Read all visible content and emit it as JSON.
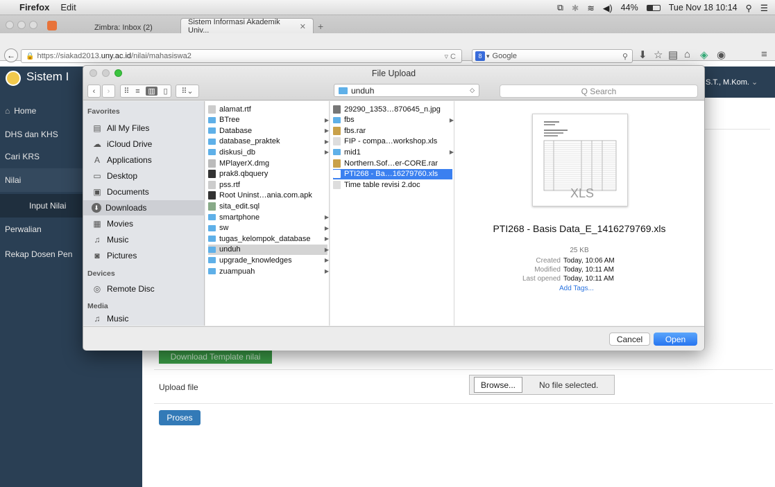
{
  "menubar": {
    "app_name": "Firefox",
    "menus": [
      "Edit"
    ],
    "battery": "44%",
    "clock": "Tue Nov 18  10:14"
  },
  "tabs": [
    {
      "label": "Zimbra: Inbox (2)"
    },
    {
      "label": "Sistem Informasi Akademik Univ..."
    }
  ],
  "url": {
    "prefix": "https://siakad2013.",
    "domain": "uny.ac.id",
    "path": "/nilai/mahasiswa2"
  },
  "search_engine": "Google",
  "site": {
    "title": "Sistem I",
    "user": "S.T., M.Kom.",
    "sidebar": [
      {
        "label": "Home",
        "icon": "home-icon"
      },
      {
        "label": "DHS dan KHS"
      },
      {
        "label": "Cari KRS"
      },
      {
        "label": "Nilai"
      },
      {
        "label": "Input Nilai"
      },
      {
        "label": "Perwalian"
      },
      {
        "label": "Rekap Dosen Pen"
      }
    ],
    "download_template": "Download Template nilai",
    "upload_label": "Upload file",
    "browse": "Browse...",
    "no_file": "No file selected.",
    "proses": "Proses"
  },
  "dialog": {
    "title": "File Upload",
    "location": "unduh",
    "search_placeholder": "Q Search",
    "favorites_heading": "Favorites",
    "favorites": [
      "All My Files",
      "iCloud Drive",
      "Applications",
      "Desktop",
      "Documents",
      "Downloads",
      "Movies",
      "Music",
      "Pictures"
    ],
    "devices_heading": "Devices",
    "devices": [
      "Remote Disc"
    ],
    "media_heading": "Media",
    "media": [
      "Music"
    ],
    "column1": [
      "alamat.rtf",
      "BTree",
      "Database",
      "database_praktek",
      "diskusi_db",
      "MPlayerX.dmg",
      "prak8.qbquery",
      "pss.rtf",
      "Root Uninst…ania.com.apk",
      "sita_edit.sql",
      "smartphone",
      "sw",
      "tugas_kelompok_database",
      "unduh",
      "upgrade_knowledges",
      "zuampuah"
    ],
    "column2": [
      "29290_1353…870645_n.jpg",
      "fbs",
      "fbs.rar",
      "FIP - compa…workshop.xls",
      "mid1",
      "Northern.Sof…er-CORE.rar",
      "PTI268 - Ba…16279760.xls",
      "Time table revisi 2.doc"
    ],
    "preview": {
      "icon_label": "XLS",
      "name": "PTI268 - Basis Data_E_1416279769.xls",
      "size": "25 KB",
      "created_label": "Created",
      "created": "Today, 10:06 AM",
      "modified_label": "Modified",
      "modified": "Today, 10:11 AM",
      "opened_label": "Last opened",
      "opened": "Today, 10:11 AM",
      "add_tags": "Add Tags..."
    },
    "cancel": "Cancel",
    "open": "Open"
  }
}
